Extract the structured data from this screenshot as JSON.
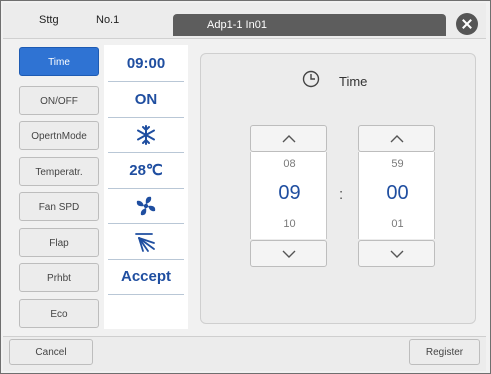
{
  "header": {
    "settings_label": "Sttg",
    "number_label": "No.1",
    "unit_label": "Adp1-1 In01"
  },
  "menu": [
    {
      "label": "Time",
      "active": true
    },
    {
      "label": "ON/OFF"
    },
    {
      "label": "OpertnMode"
    },
    {
      "label": "Temperatr."
    },
    {
      "label": "Fan SPD"
    },
    {
      "label": "Flap"
    },
    {
      "label": "Prhbt"
    },
    {
      "label": "Eco"
    }
  ],
  "values": {
    "time": "09:00",
    "onoff": "ON",
    "mode_icon": "snowflake-icon",
    "temperature": "28℃",
    "fan_icon": "fan-icon",
    "flap_icon": "flap-icon",
    "prohibit": "Accept"
  },
  "panel": {
    "title": "Time",
    "icon": "clock-icon",
    "hour": {
      "prev": "08",
      "current": "09",
      "next": "10"
    },
    "minute": {
      "prev": "59",
      "current": "00",
      "next": "01"
    },
    "separator": ":"
  },
  "footer": {
    "cancel_label": "Cancel",
    "register_label": "Register"
  },
  "colors": {
    "accent": "#2f73d3",
    "value_text": "#1f4ea0",
    "header_tab": "#5d5d5d"
  }
}
